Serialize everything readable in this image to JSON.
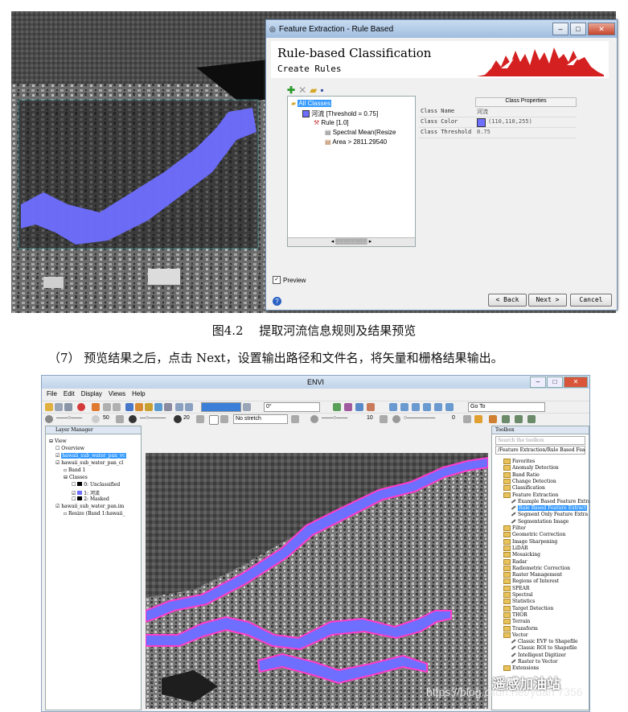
{
  "top_dialog": {
    "window_title": "Feature Extraction - Rule Based",
    "heading": "Rule-based Classification",
    "subheading": "Create Rules",
    "tree": {
      "root": "All Classes",
      "class_node": "河流 [Threshold = 0.75]",
      "rule_node": "Rule [1.0]",
      "attr1": "Spectral Mean(Resize",
      "attr2": "Area > 2811.29540"
    },
    "properties": {
      "title": "Class Properties",
      "rows": [
        {
          "key": "Class Name",
          "value": "河流"
        },
        {
          "key": "Class Color",
          "value": "(110,110,255)"
        },
        {
          "key": "Class Threshold",
          "value": "0.75"
        }
      ]
    },
    "preview_label": "Preview",
    "buttons": {
      "back": "< Back",
      "next": "Next >",
      "cancel": "Cancel"
    },
    "help": "?"
  },
  "caption": "图4.2　 提取河流信息规则及结果预览",
  "step_text": "（7）  预览结果之后，点击 Next，设置输出路径和文件名，将矢量和栅格结果输出。",
  "envi": {
    "title": "ENVI",
    "menu": [
      "File",
      "Edit",
      "Display",
      "Views",
      "Help"
    ],
    "toolbar": {
      "rotation": "0°",
      "goto": "Go To",
      "stretch": "No stretch",
      "val1": "50",
      "val2": "20",
      "val3": "10",
      "val4": "0"
    },
    "layer_manager": {
      "title": "Layer Manager",
      "rows": [
        "View",
        "Overview",
        "hawaii_sub_water_pan_vc",
        "hawaii_sub_water_pan_cl",
        "Band 1",
        "Classes",
        "0: Unclassified",
        "1: 河流",
        "2: Masked",
        "hawaii_sub_water_pan.im",
        "Resize (Band 1:hawaii_"
      ]
    },
    "toolbox": {
      "title": "Toolbox",
      "search_placeholder": "Search the toolbox",
      "path": "/Feature Extraction/Rule Based Featu",
      "items": [
        {
          "label": "Favorites",
          "sub": false
        },
        {
          "label": "Anomaly Detection",
          "sub": false
        },
        {
          "label": "Band Ratio",
          "sub": false
        },
        {
          "label": "Change Detection",
          "sub": false
        },
        {
          "label": "Classification",
          "sub": false
        },
        {
          "label": "Feature Extraction",
          "sub": false
        },
        {
          "label": "Example Based Feature Extra",
          "sub": true
        },
        {
          "label": "Rule Based Feature Extract",
          "sub": true,
          "selected": true
        },
        {
          "label": "Segment Only Feature Extra",
          "sub": true
        },
        {
          "label": "Segmentation Image",
          "sub": true
        },
        {
          "label": "Filter",
          "sub": false
        },
        {
          "label": "Geometric Correction",
          "sub": false
        },
        {
          "label": "Image Sharpening",
          "sub": false
        },
        {
          "label": "LiDAR",
          "sub": false
        },
        {
          "label": "Mosaicking",
          "sub": false
        },
        {
          "label": "Radar",
          "sub": false
        },
        {
          "label": "Radiometric Correction",
          "sub": false
        },
        {
          "label": "Raster Management",
          "sub": false
        },
        {
          "label": "Regions of Interest",
          "sub": false
        },
        {
          "label": "SPEAR",
          "sub": false
        },
        {
          "label": "Spectral",
          "sub": false
        },
        {
          "label": "Statistics",
          "sub": false
        },
        {
          "label": "Target Detection",
          "sub": false
        },
        {
          "label": "THOR",
          "sub": false
        },
        {
          "label": "Terrain",
          "sub": false
        },
        {
          "label": "Transform",
          "sub": false
        },
        {
          "label": "Vector",
          "sub": false
        },
        {
          "label": "Classic EVF to Shapefile",
          "sub": true
        },
        {
          "label": "Classic ROI to Shapefile",
          "sub": true
        },
        {
          "label": "Intelligent Digitizer",
          "sub": true
        },
        {
          "label": "Raster to Vector",
          "sub": true
        },
        {
          "label": "Extensions",
          "sub": false
        }
      ]
    }
  },
  "watermark": {
    "url": "https://blog.csdn.net/yuan       7356",
    "brand": "遥感加油站"
  },
  "colors": {
    "class_color": "#6e6eff",
    "river_outline": "#ff3cc8",
    "selection": "#3399ff"
  }
}
